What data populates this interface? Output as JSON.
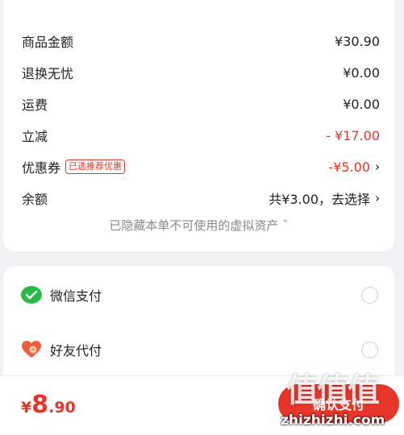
{
  "summary": {
    "rows": [
      {
        "label": "商品金额",
        "value": "¥30.90"
      },
      {
        "label": "退换无忧",
        "value": "¥0.00"
      },
      {
        "label": "运费",
        "value": "¥0.00"
      },
      {
        "label": "立减",
        "value": "- ¥17.00"
      },
      {
        "label": "优惠券",
        "badge": "已选推荐优惠",
        "value": "-¥5.00"
      },
      {
        "label": "余额",
        "value": "共¥3.00，去选择"
      }
    ],
    "hidden_assets_note": "已隐藏本单不可使用的虚拟资产 ˇ"
  },
  "payment": {
    "methods": [
      {
        "label": "微信支付",
        "icon": "wechat-icon"
      },
      {
        "label": "好友代付",
        "icon": "heart-icon"
      }
    ]
  },
  "footer": {
    "currency": "¥",
    "price_int": "8",
    "price_dec": ".90",
    "pay_button": "确认支付"
  },
  "watermark": {
    "text": "值值值",
    "url": "zhizhizhi.com"
  },
  "colors": {
    "accent": "#e5342a",
    "wechat": "#2bba49"
  }
}
